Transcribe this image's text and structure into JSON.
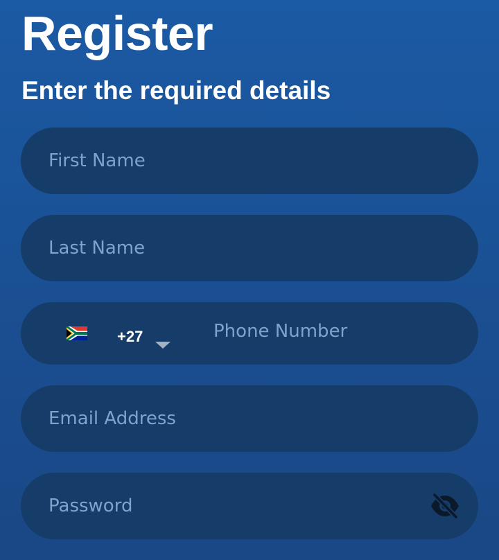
{
  "header": {
    "title": "Register",
    "subtitle": "Enter the required details"
  },
  "form": {
    "first_name": {
      "placeholder": "First Name",
      "value": ""
    },
    "last_name": {
      "placeholder": "Last Name",
      "value": ""
    },
    "phone": {
      "country_flag": "south-africa-flag",
      "country_code": "+27",
      "placeholder": "Phone Number",
      "value": ""
    },
    "email": {
      "placeholder": "Email Address",
      "value": ""
    },
    "password": {
      "placeholder": "Password",
      "value": "",
      "visibility_icon": "eye-off-icon"
    }
  },
  "colors": {
    "background": "#1b5aa4",
    "field": "#163c69",
    "placeholder": "#7fa4cc",
    "text": "#ffffff"
  }
}
